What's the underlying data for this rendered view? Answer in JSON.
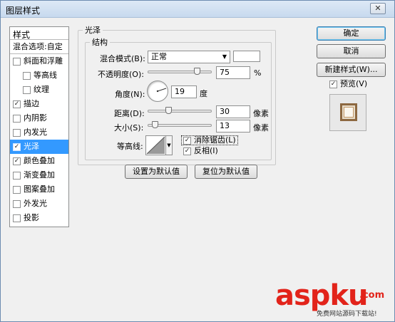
{
  "window": {
    "title": "图层样式",
    "close_icon": "close-icon"
  },
  "styles": {
    "header": "样式",
    "blend_options": "混合选项:自定",
    "items": [
      {
        "label": "斜面和浮雕",
        "checked": false
      },
      {
        "label": "等高线",
        "checked": false
      },
      {
        "label": "纹理",
        "checked": false
      },
      {
        "label": "描边",
        "checked": true
      },
      {
        "label": "内阴影",
        "checked": false
      },
      {
        "label": "内发光",
        "checked": false
      },
      {
        "label": "光泽",
        "checked": true
      },
      {
        "label": "颜色叠加",
        "checked": true
      },
      {
        "label": "渐变叠加",
        "checked": false
      },
      {
        "label": "图案叠加",
        "checked": false
      },
      {
        "label": "外发光",
        "checked": false
      },
      {
        "label": "投影",
        "checked": false
      }
    ]
  },
  "satin": {
    "group_title": "光泽",
    "structure_title": "结构",
    "blend_mode_label": "混合模式(B):",
    "blend_mode_value": "正常",
    "opacity_label": "不透明度(O):",
    "opacity_value": "75",
    "opacity_unit": "%",
    "angle_label": "角度(N):",
    "angle_value": "19",
    "angle_unit": "度",
    "distance_label": "距离(D):",
    "distance_value": "30",
    "distance_unit": "像素",
    "size_label": "大小(S):",
    "size_value": "13",
    "size_unit": "像素",
    "contour_label": "等高线:",
    "antialias_label": "消除锯齿(L)",
    "antialias_checked": true,
    "invert_label": "反相(I)",
    "invert_checked": true,
    "set_default_label": "设置为默认值",
    "reset_default_label": "复位为默认值"
  },
  "actions": {
    "ok_label": "确定",
    "cancel_label": "取消",
    "new_style_label": "新建样式(W)...",
    "preview_label": "预览(V)",
    "preview_checked": true
  },
  "watermark": {
    "logo": "asp",
    "logo2": "ku",
    "tld": ".com",
    "sub": "免费网站源码下载站!"
  }
}
